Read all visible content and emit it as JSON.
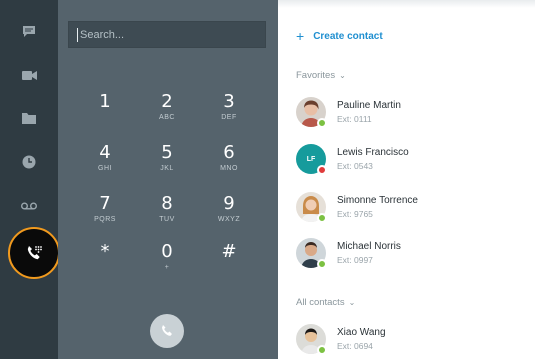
{
  "colors": {
    "rail_bg": "#2f3b42",
    "dialpad_bg": "#55636c",
    "accent_blue": "#1f8fd0",
    "highlight_ring": "#f19a1e",
    "presence_available": "#7cc142",
    "presence_busy": "#e03b3b"
  },
  "rail": {
    "items": [
      {
        "icon": "chat-icon"
      },
      {
        "icon": "video-camera-icon"
      },
      {
        "icon": "folder-icon"
      },
      {
        "icon": "clock-icon"
      },
      {
        "icon": "voicemail-icon"
      },
      {
        "icon": "dialpad-call-icon",
        "active": true
      }
    ]
  },
  "dialpad": {
    "search_placeholder": "Search...",
    "keys": [
      {
        "digit": "1",
        "letters": ""
      },
      {
        "digit": "2",
        "letters": "ABC"
      },
      {
        "digit": "3",
        "letters": "DEF"
      },
      {
        "digit": "4",
        "letters": "GHI"
      },
      {
        "digit": "5",
        "letters": "JKL"
      },
      {
        "digit": "6",
        "letters": "MNO"
      },
      {
        "digit": "7",
        "letters": "PQRS"
      },
      {
        "digit": "8",
        "letters": "TUV"
      },
      {
        "digit": "9",
        "letters": "WXYZ"
      },
      {
        "digit": "*",
        "letters": ""
      },
      {
        "digit": "0",
        "letters": "+"
      },
      {
        "digit": "#",
        "letters": ""
      }
    ],
    "call_icon": "phone-icon"
  },
  "contacts": {
    "create_label": "Create contact",
    "favorites_label": "Favorites",
    "all_label": "All contacts",
    "favorites": [
      {
        "name": "Pauline Martin",
        "ext": "Ext: 0111",
        "presence": "available",
        "avatar": "photo"
      },
      {
        "name": "Lewis Francisco",
        "ext": "Ext: 0543",
        "presence": "busy",
        "avatar": "initials",
        "initials": "LF"
      },
      {
        "name": "Simonne Torrence",
        "ext": "Ext: 9765",
        "presence": "available",
        "avatar": "photo"
      },
      {
        "name": "Michael Norris",
        "ext": "Ext: 0997",
        "presence": "available",
        "avatar": "photo"
      }
    ],
    "all": [
      {
        "name": "Xiao Wang",
        "ext": "Ext: 0694",
        "presence": "available",
        "avatar": "photo"
      }
    ]
  }
}
